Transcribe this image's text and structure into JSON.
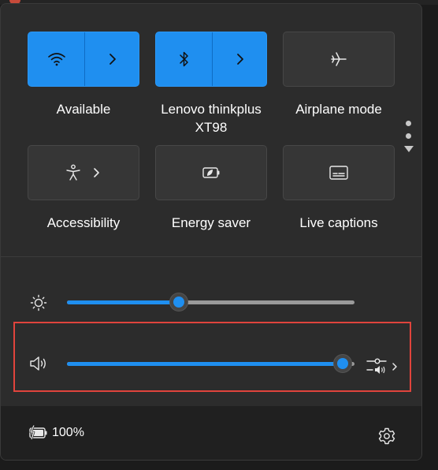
{
  "quick_actions": [
    {
      "label": "Available",
      "icon": "wifi-icon",
      "state": "on",
      "has_arrow": true
    },
    {
      "label": "Lenovo thinkplus XT98",
      "icon": "bluetooth-icon",
      "state": "on",
      "has_arrow": true
    },
    {
      "label": "Airplane mode",
      "icon": "airplane-icon",
      "state": "off",
      "has_arrow": false
    },
    {
      "label": "Accessibility",
      "icon": "accessibility-icon",
      "state": "off",
      "has_arrow": true
    },
    {
      "label": "Energy saver",
      "icon": "energy-saver-icon",
      "state": "off",
      "has_arrow": false
    },
    {
      "label": "Live captions",
      "icon": "live-captions-icon",
      "state": "off",
      "has_arrow": false
    }
  ],
  "sliders": {
    "brightness": {
      "icon": "brightness-icon",
      "level_percent": 39
    },
    "volume": {
      "icon": "speaker-icon",
      "level_percent": 96
    }
  },
  "footer": {
    "battery_text": "100%",
    "battery_icon": "battery-charging-icon",
    "settings_icon": "gear-icon"
  },
  "colors": {
    "accent": "#1f8ff0",
    "panel": "#2c2c2c",
    "highlight": "#e0443c"
  }
}
